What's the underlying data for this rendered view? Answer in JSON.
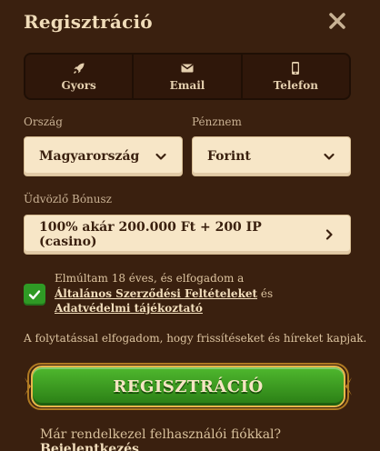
{
  "header": {
    "title": "Regisztráció"
  },
  "tabs": [
    {
      "label": "Gyors",
      "icon": "rocket-icon"
    },
    {
      "label": "Email",
      "icon": "envelope-icon"
    },
    {
      "label": "Telefon",
      "icon": "phone-icon"
    }
  ],
  "form": {
    "country_label": "Ország",
    "country_value": "Magyarország",
    "currency_label": "Pénznem",
    "currency_value": "Forint",
    "bonus_label": "Üdvözlő Bónusz",
    "bonus_value": "100% akár 200.000 Ft + 200 IP (casino)"
  },
  "terms": {
    "line1": "Elmúltam 18 éves, és elfogadom a",
    "terms_link": "Általános Szerződési Feltételeket",
    "and": "és",
    "privacy_link": "Adatvédelmi tájékoztató",
    "checked": true
  },
  "consent_text": "A folytatással elfogadom, hogy frissítéseket és híreket kapjak.",
  "submit_label": "REGISZTRÁCIÓ",
  "footer": {
    "question": "Már rendelkezel felhasználói fiókkal?",
    "login_link": "Bejelentkezés"
  },
  "colors": {
    "background": "#3a200f",
    "accent_green": "#2f9a25",
    "gold": "#e8b64a",
    "field": "#f7e6c7"
  }
}
